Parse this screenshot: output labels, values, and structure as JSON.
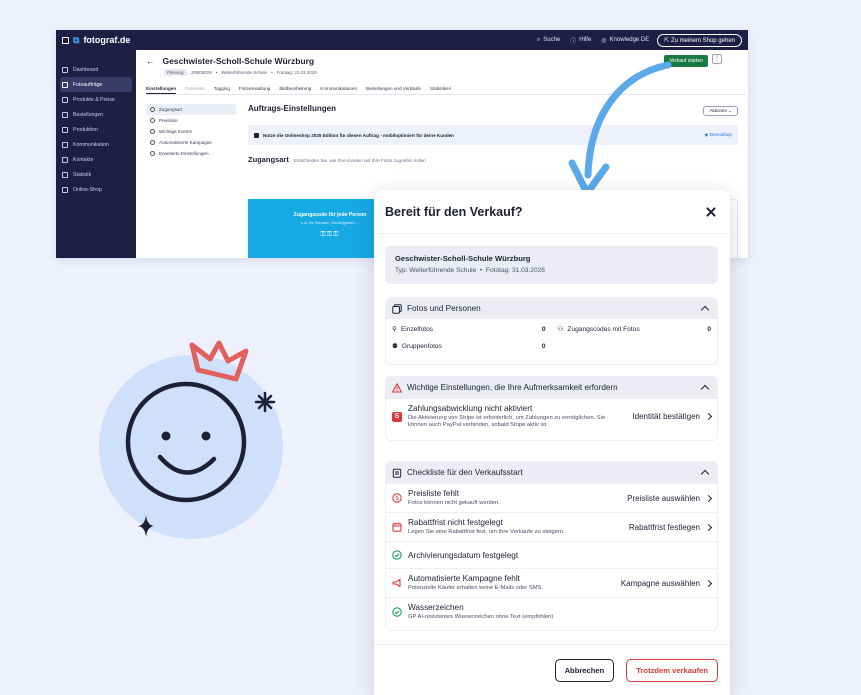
{
  "topbar": {
    "logo": "fotograf.de",
    "search": "Suche",
    "help": "Hilfe",
    "knowledge": "Knowledge DE",
    "shop": "Zu meinem Shop gehen"
  },
  "sidebar": {
    "items": [
      {
        "label": "Dashboard"
      },
      {
        "label": "Fotoaufträge"
      },
      {
        "label": "Produkte & Preise"
      },
      {
        "label": "Bestellungen"
      },
      {
        "label": "Produktion"
      },
      {
        "label": "Kommunikation"
      },
      {
        "label": "Kontakte"
      },
      {
        "label": "Statistik"
      },
      {
        "label": "Online-Shop"
      }
    ]
  },
  "job": {
    "title": "Geschwister-Scholl-Schule Würzburg",
    "status": "Planung",
    "id": "JOB00029",
    "type": "Weiterführende Schule",
    "date": "Fototag: 31.03.2026",
    "start_label": "Verkauf starten"
  },
  "tabs": [
    "Einstellungen",
    "Personen",
    "Tagging",
    "Fotoverwaltung",
    "Bildbearbeitung",
    "Kommunikationen",
    "Bestellungen und Verkäufe",
    "Statistiken"
  ],
  "subnav": [
    "Zugangsart",
    "Preisliste",
    "Wichtige Events",
    "Automatisierte Kampagne",
    "Erweiterte Einstellungen"
  ],
  "content": {
    "heading": "Auftrags-Einstellungen",
    "actions": "Aktionen",
    "infobar": "Nutze die Onlineshop 2025 Edition für diesen Auftrag - mobiloptimiert für deine Kunden",
    "demo": "Demoshop",
    "zugang_title": "Zugangsart",
    "zugang_desc": "Entscheiden Sie, wie Ihre Kunden auf Ihre Fotos zugreifen sollen",
    "tile_title": "Zugangscode für jede Person",
    "tile_sub": "z.B. für Schulen, Kindergärten,..."
  },
  "dialog": {
    "title": "Bereit für den Verkauf?",
    "summary_title": "Geschwister-Scholl-Schule Würzburg",
    "summary_type": "Typ: Weiterführende Schule",
    "summary_date": "Fototag: 31.03.2026",
    "fotos_section": "Fotos und Personen",
    "stats": {
      "einzelfotos_label": "Einzelfotos",
      "einzelfotos_value": "0",
      "zugangscodes_label": "Zugangscodes mit Fotos",
      "zugangscodes_value": "0",
      "gruppenfotos_label": "Gruppenfotos",
      "gruppenfotos_value": "0"
    },
    "warning_section": "Wichtige Einstellungen, die Ihre Aufmerksamkeit erfordern",
    "stripe": {
      "badge": "S",
      "title": "Zahlungsabwicklung nicht aktiviert",
      "desc": "Die Aktivierung von Stripe ist erforderlich, um Zahlungen zu ermöglichen. Sie können auch PayPal verbinden, sobald Stripe aktiv ist",
      "action": "Identität bestätigen"
    },
    "checklist_section": "Checkliste für den Verkaufsstart",
    "checklist": [
      {
        "title": "Preisliste fehlt",
        "desc": "Fotos können nicht gekauft werden.",
        "action": "Preisliste auswählen"
      },
      {
        "title": "Rabattfrist nicht festgelegt",
        "desc": "Legen Sie eine Rabattfrist fest, um Ihre Verkäufe zu steigern.",
        "action": "Rabattfrist festlegen"
      },
      {
        "title": "Archivierungsdatum festgelegt",
        "desc": "",
        "action": ""
      },
      {
        "title": "Automatisierte Kampagne fehlt",
        "desc": "Potenzielle Käufer erhalten keine E-Mails oder SMS.",
        "action": "Kampagne auswählen"
      },
      {
        "title": "Wasserzeichen",
        "desc": "GP AI-resistentes Wasserzeichen ohne Text (empfohlen)",
        "action": ""
      }
    ],
    "cancel": "Abbrechen",
    "sell_anyway": "Trotzdem verkaufen"
  },
  "colors": {
    "navy": "#1f1f45",
    "green": "#1b7a44",
    "red": "#d93a3a",
    "success": "#1f9a5a",
    "arrow": "#5aa9e8",
    "smiley_circle": "#cfe0fb",
    "crown": "#e2605e"
  }
}
